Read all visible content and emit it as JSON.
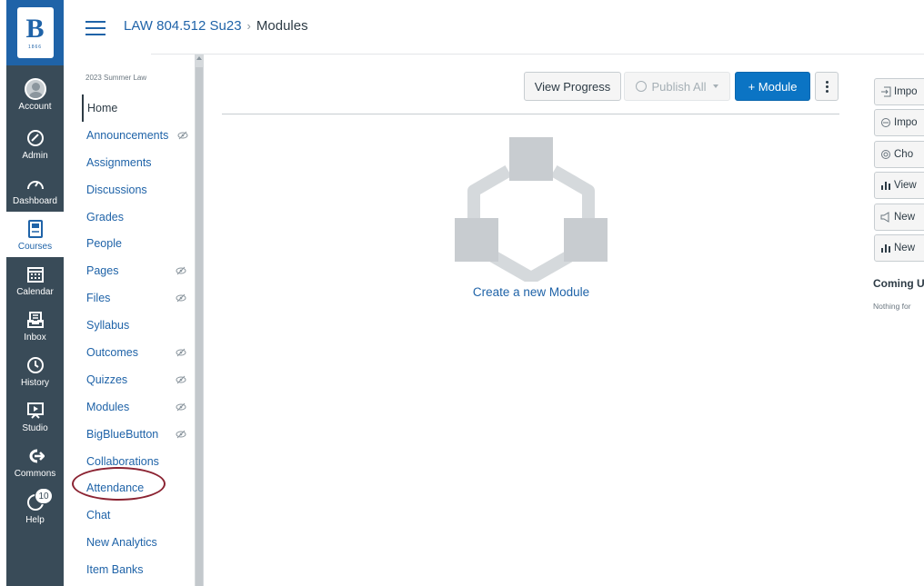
{
  "global_nav": {
    "logo_letter": "B",
    "logo_sub": "1866",
    "items": [
      {
        "label": "Account",
        "icon": "account-avatar"
      },
      {
        "label": "Admin",
        "icon": "shield-icon"
      },
      {
        "label": "Dashboard",
        "icon": "dashboard-gauge-icon"
      },
      {
        "label": "Courses",
        "icon": "book-icon"
      },
      {
        "label": "Calendar",
        "icon": "calendar-icon"
      },
      {
        "label": "Inbox",
        "icon": "inbox-icon"
      },
      {
        "label": "History",
        "icon": "clock-icon"
      },
      {
        "label": "Studio",
        "icon": "studio-icon"
      },
      {
        "label": "Commons",
        "icon": "commons-icon"
      },
      {
        "label": "Help",
        "icon": "help-icon",
        "badge": "10"
      }
    ]
  },
  "header": {
    "breadcrumb": {
      "course": "LAW 804.512 Su23",
      "separator": "›",
      "current": "Modules"
    }
  },
  "course_nav": {
    "term": "2023 Summer Law",
    "items": [
      {
        "label": "Home",
        "active": true,
        "hidden": false
      },
      {
        "label": "Announcements",
        "active": false,
        "hidden": true
      },
      {
        "label": "Assignments",
        "active": false,
        "hidden": false
      },
      {
        "label": "Discussions",
        "active": false,
        "hidden": false
      },
      {
        "label": "Grades",
        "active": false,
        "hidden": false
      },
      {
        "label": "People",
        "active": false,
        "hidden": false
      },
      {
        "label": "Pages",
        "active": false,
        "hidden": true
      },
      {
        "label": "Files",
        "active": false,
        "hidden": true
      },
      {
        "label": "Syllabus",
        "active": false,
        "hidden": false
      },
      {
        "label": "Outcomes",
        "active": false,
        "hidden": true
      },
      {
        "label": "Quizzes",
        "active": false,
        "hidden": true
      },
      {
        "label": "Modules",
        "active": false,
        "hidden": true
      },
      {
        "label": "BigBlueButton",
        "active": false,
        "hidden": true
      },
      {
        "label": "Collaborations",
        "active": false,
        "hidden": false
      },
      {
        "label": "Attendance",
        "active": false,
        "hidden": false
      },
      {
        "label": "Chat",
        "active": false,
        "hidden": false
      },
      {
        "label": "New Analytics",
        "active": false,
        "hidden": false
      },
      {
        "label": "Item Banks",
        "active": false,
        "hidden": false
      }
    ]
  },
  "toolbar": {
    "view_progress": "View Progress",
    "publish_all": "Publish All",
    "add_module": "+ Module"
  },
  "empty_state": {
    "link": "Create a new Module"
  },
  "sidebar": {
    "buttons": [
      {
        "label": "Impo",
        "icon": "import-icon"
      },
      {
        "label": "Impo",
        "icon": "import-commons-icon"
      },
      {
        "label": "Cho",
        "icon": "choose-home-icon"
      },
      {
        "label": "View",
        "icon": "bar-chart-icon"
      },
      {
        "label": "New",
        "icon": "announcement-icon"
      },
      {
        "label": "New",
        "icon": "bar-chart-icon"
      }
    ],
    "coming_up_title": "Coming U",
    "coming_up_text": "Nothing for"
  },
  "colors": {
    "brand_blue": "#1f63a8",
    "nav_dark": "#394b58",
    "primary_button": "#0b74c4",
    "annotation_circle": "#8b2332"
  }
}
